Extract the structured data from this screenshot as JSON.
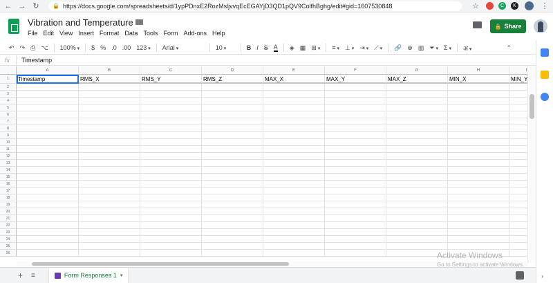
{
  "browser": {
    "url": "https://docs.google.com/spreadsheets/d/1ypPDnxE2RozMsljvvqEcEGAYjD3QD1pQV9ColfhBghg/edit#gid=1607530848",
    "nav_icons": [
      "back-icon",
      "forward-icon",
      "reload-icon"
    ],
    "extensions": [
      {
        "name": "star-bookmark-icon",
        "color": "#5f6368",
        "glyph": "☆"
      },
      {
        "name": "extension-red-icon",
        "color": "#e8453c",
        "glyph": ""
      },
      {
        "name": "extension-green-icon",
        "color": "#1aa260",
        "glyph": "C"
      },
      {
        "name": "extension-dark-icon",
        "color": "#202124",
        "glyph": "K"
      }
    ]
  },
  "doc": {
    "title": "Vibration and Temperature",
    "menu": [
      "File",
      "Edit",
      "View",
      "Insert",
      "Format",
      "Data",
      "Tools",
      "Form",
      "Add-ons",
      "Help"
    ],
    "share_label": "Share",
    "brand_color": "#0f9d58",
    "share_color": "#188038"
  },
  "toolbar": {
    "zoom": "100%",
    "currency": "$",
    "percent": "%",
    "decimal_less": ".0",
    "decimal_more": ".00",
    "number_format": "123",
    "font": "Arial",
    "font_size": "10",
    "bold": "B",
    "italic": "I",
    "strike": "S",
    "text_color": "A",
    "sum": "Σ",
    "input_tools": "अ"
  },
  "formula_bar": {
    "fx_label": "fx",
    "value": "Timestamp"
  },
  "grid": {
    "columns": [
      "A",
      "B",
      "C",
      "D",
      "E",
      "F",
      "G",
      "H",
      "I"
    ],
    "row_numbers": [
      "1",
      "2",
      "3",
      "4",
      "5",
      "6",
      "7",
      "8",
      "9",
      "10",
      "11",
      "12",
      "13",
      "14",
      "15",
      "16",
      "17",
      "18",
      "19",
      "20",
      "21",
      "22",
      "23",
      "24",
      "25",
      "26"
    ],
    "header_row": [
      "Timestamp",
      "RMS_X",
      "RMS_Y",
      "RMS_Z",
      "MAX_X",
      "MAX_Y",
      "MAX_Z",
      "MIN_X",
      "MIN_Y"
    ],
    "selected_cell": "A1"
  },
  "sheets": {
    "add_label": "+",
    "list_label": "≡",
    "active_tab": "Form Responses 1"
  },
  "watermark": {
    "line1": "Activate Windows",
    "line2": "Go to Settings to activate Windows."
  }
}
